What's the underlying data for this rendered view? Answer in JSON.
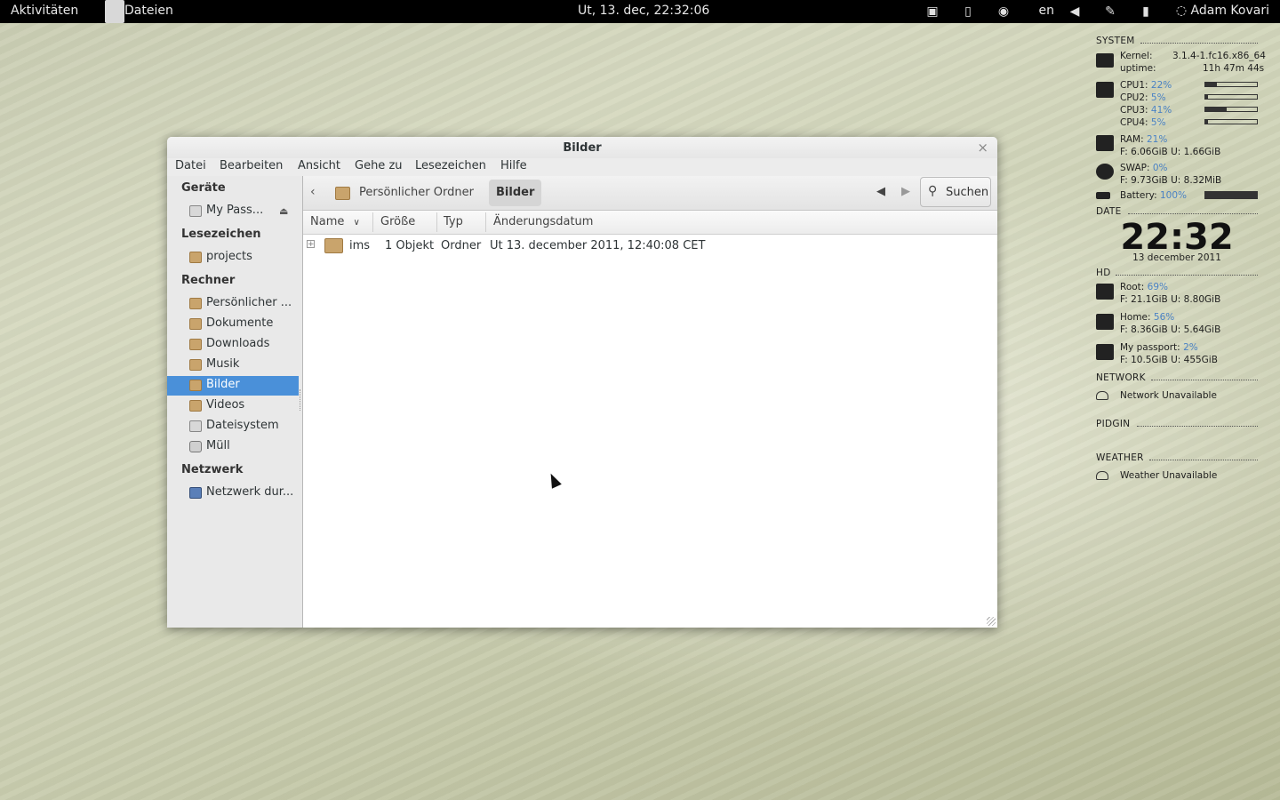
{
  "topbar": {
    "activities": "Aktivitäten",
    "app_name": "Dateien",
    "clock": "Ut, 13. dec, 22:32:06",
    "lang": "en",
    "user": "Adam Kovari"
  },
  "window": {
    "title": "Bilder",
    "menu": [
      "Datei",
      "Bearbeiten",
      "Ansicht",
      "Gehe zu",
      "Lesezeichen",
      "Hilfe"
    ]
  },
  "sidebar": {
    "devices_header": "Geräte",
    "device_item": "My Pass...",
    "bookmarks_header": "Lesezeichen",
    "bookmark_item": "projects",
    "computer_header": "Rechner",
    "computer_items": [
      "Persönlicher ...",
      "Dokumente",
      "Downloads",
      "Musik",
      "Bilder",
      "Videos",
      "Dateisystem",
      "Müll"
    ],
    "network_header": "Netzwerk",
    "network_item": "Netzwerk dur..."
  },
  "pathbar": {
    "crumb_home": "Persönlicher Ordner",
    "crumb_current": "Bilder",
    "search_label": "Suchen"
  },
  "columns": [
    "Name",
    "Größe",
    "Typ",
    "Änderungsdatum"
  ],
  "files": [
    {
      "name": "ims",
      "size": "1 Objekt",
      "type": "Ordner",
      "modified": "Ut 13. december 2011, 12:40:08 CET"
    }
  ],
  "conky": {
    "system_header": "SYSTEM",
    "kernel_label": "Kernel:",
    "kernel_value": "3.1.4-1.fc16.x86_64",
    "uptime_label": "uptime:",
    "uptime_value": "11h 47m 44s",
    "cpus": [
      {
        "label": "CPU1:",
        "pct": "22%",
        "level": 0.22
      },
      {
        "label": "CPU2:",
        "pct": "5%",
        "level": 0.05
      },
      {
        "label": "CPU3:",
        "pct": "41%",
        "level": 0.41
      },
      {
        "label": "CPU4:",
        "pct": "5%",
        "level": 0.05
      }
    ],
    "ram_label": "RAM:",
    "ram_pct": "21%",
    "ram_detail": "F: 6.06GiB U: 1.66GiB",
    "swap_label": "SWAP:",
    "swap_pct": "0%",
    "swap_detail": "F: 9.73GiB U: 8.32MiB",
    "battery_label": "Battery:",
    "battery_pct": "100%",
    "battery_level": 1.0,
    "date_header": "DATE",
    "time": "22:32",
    "date": "13 december 2011",
    "hd_header": "HD",
    "root_label": "Root:",
    "root_pct": "69%",
    "root_detail": "F: 21.1GiB U: 8.80GiB",
    "home_label": "Home:",
    "home_pct": "56%",
    "home_detail": "F: 8.36GiB U: 5.64GiB",
    "passport_label": "My passport:",
    "passport_pct": "2%",
    "passport_detail": "F: 10.5GiB U: 455GiB",
    "network_header": "NETWORK",
    "network_status": "Network Unavailable",
    "pidgin_header": "PIDGIN",
    "weather_header": "WEATHER",
    "weather_status": "Weather Unavailable"
  }
}
